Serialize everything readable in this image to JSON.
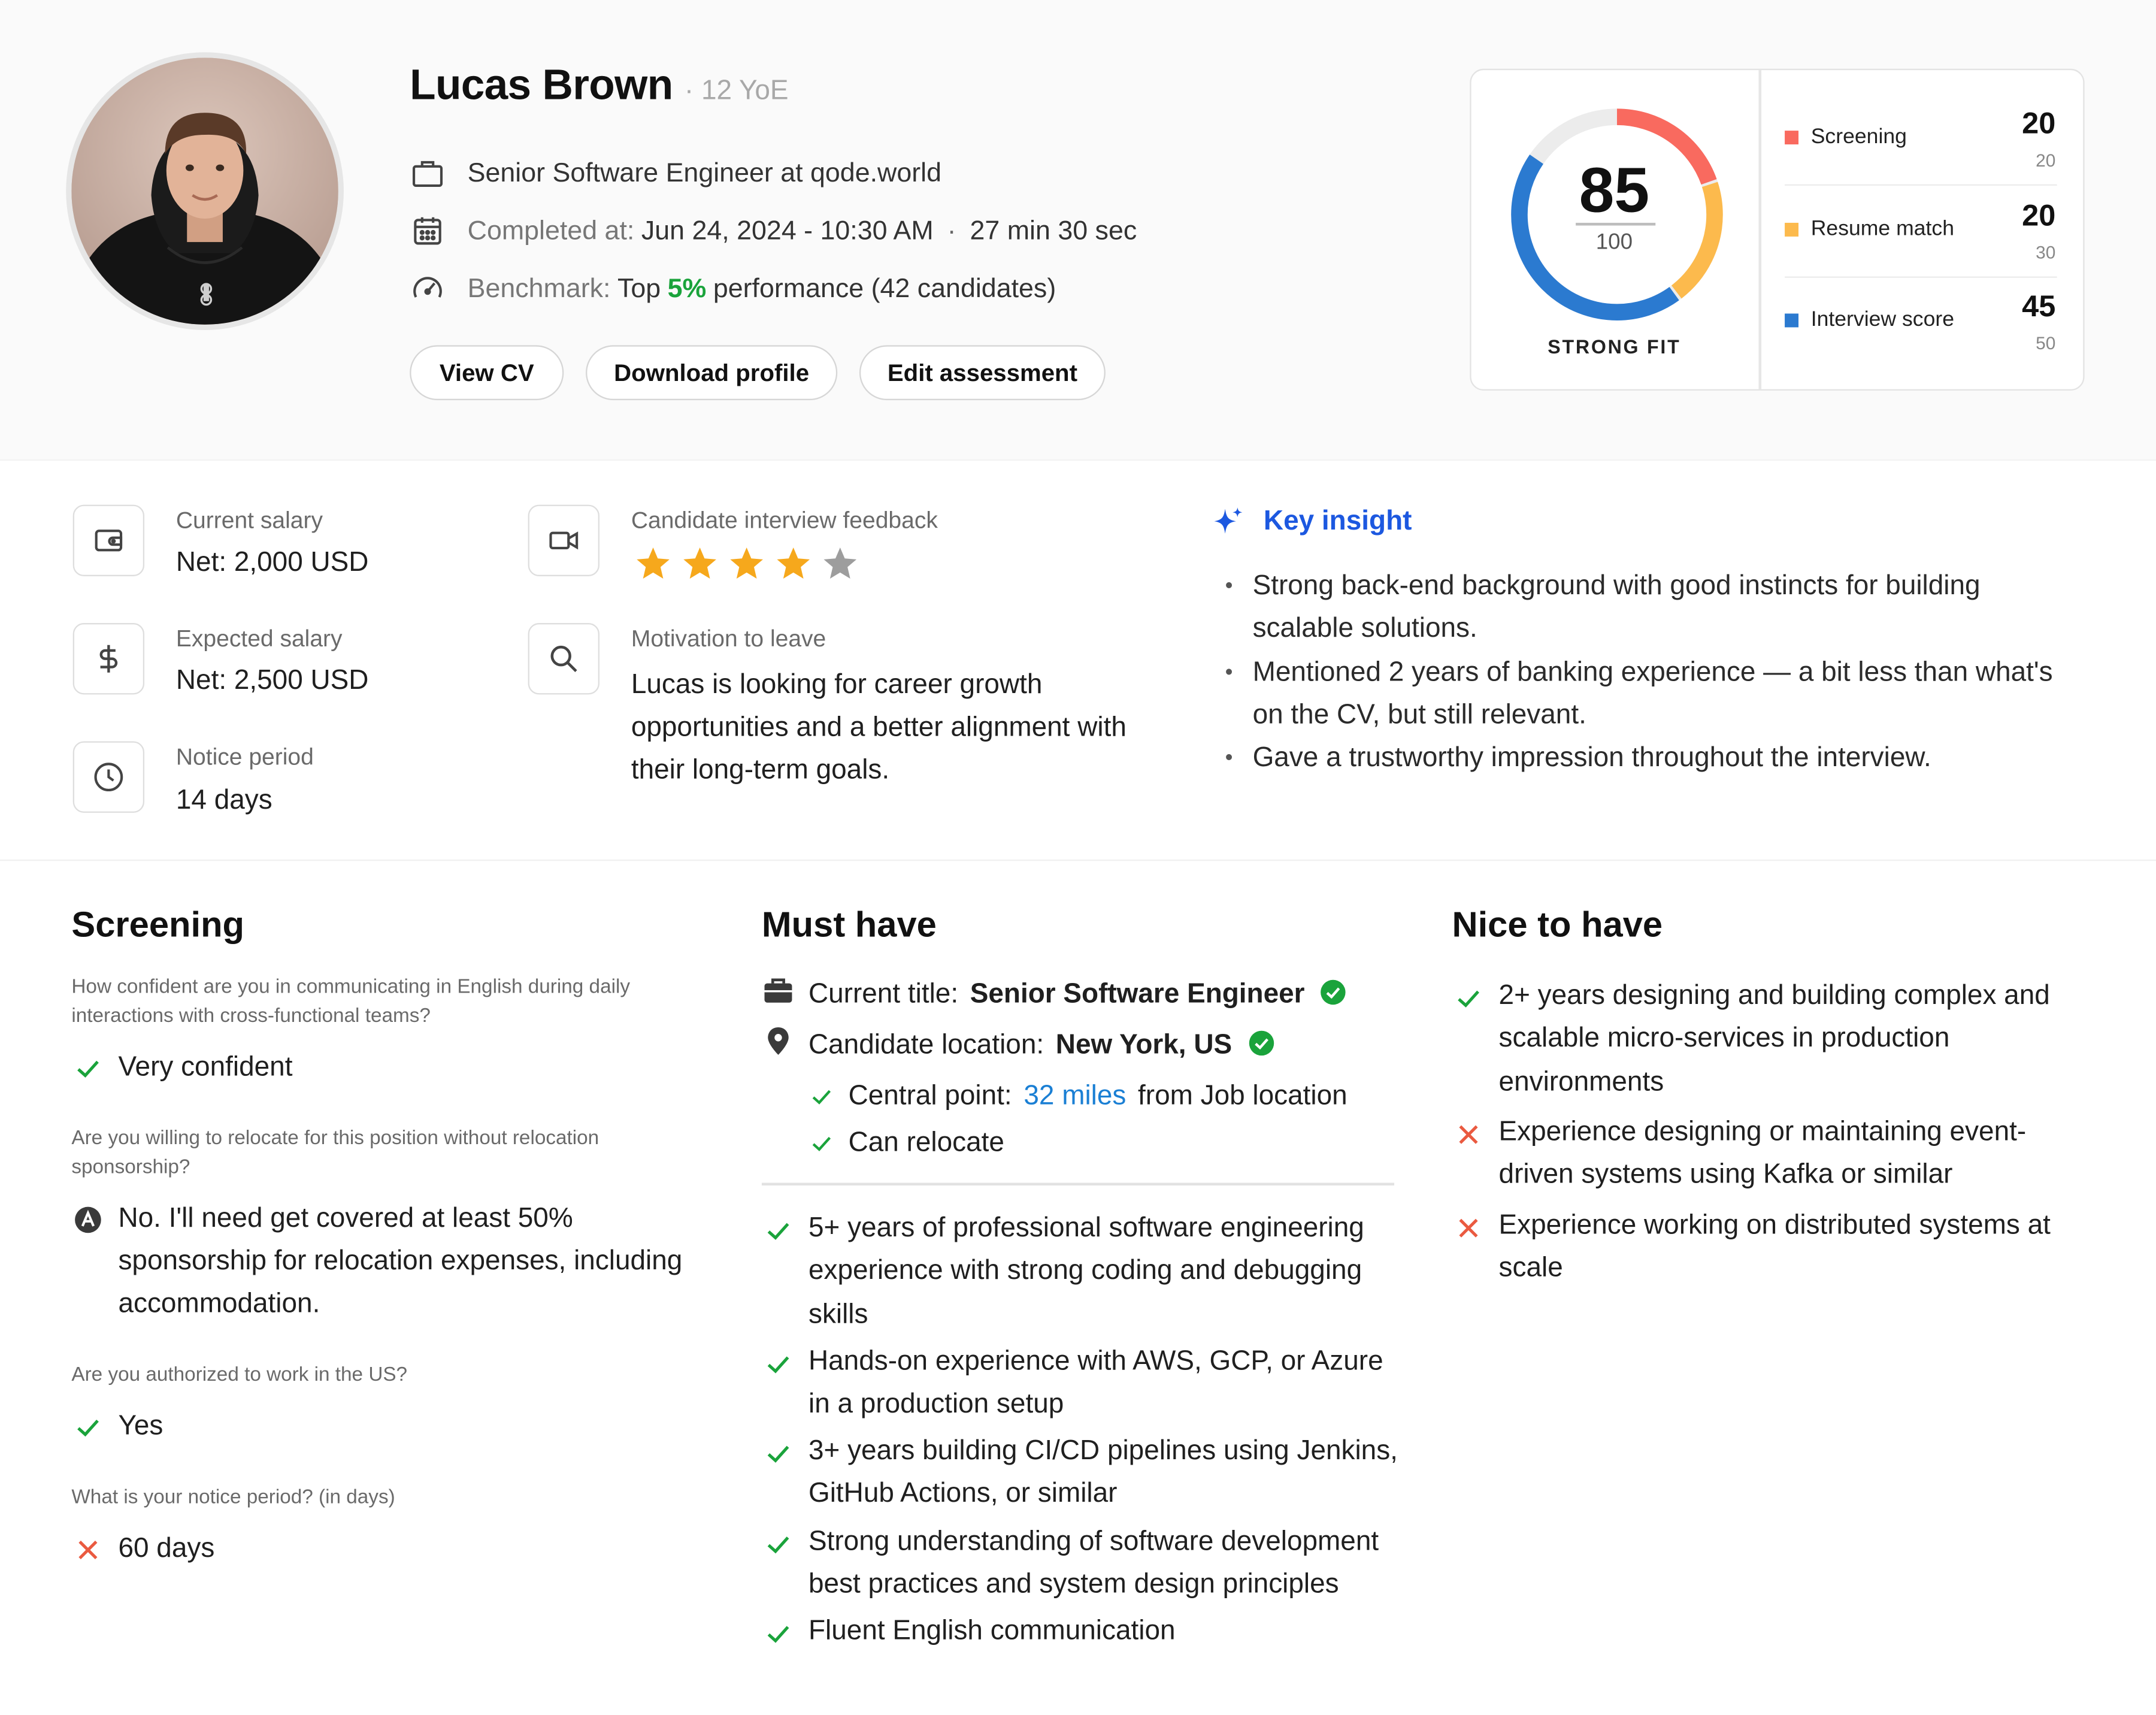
{
  "candidate": {
    "name": "Lucas Brown",
    "yoe": "· 12 YoE",
    "title": "Senior Software Engineer at qode.world",
    "completed_label": "Completed at:",
    "completed_value": "Jun 24, 2024 - 10:30 AM",
    "duration": "27 min 30 sec",
    "benchmark_label": "Benchmark:",
    "benchmark_top": "Top",
    "benchmark_pct": "5%",
    "benchmark_rest": "performance (42 candidates)"
  },
  "actions": {
    "view_cv": "View CV",
    "download": "Download profile",
    "edit": "Edit assessment"
  },
  "score": {
    "value": "85",
    "max": "100",
    "verdict": "STRONG FIT",
    "breakdown": [
      {
        "label": "Screening",
        "value": "20",
        "max": "20",
        "color": "#f96a5f"
      },
      {
        "label": "Resume match",
        "value": "20",
        "max": "30",
        "color": "#fcba4d"
      },
      {
        "label": "Interview score",
        "value": "45",
        "max": "50",
        "color": "#2b7ad0"
      }
    ],
    "track_color": "#ececec"
  },
  "details": {
    "current_salary_label": "Current salary",
    "current_salary": "Net: 2,000 USD",
    "expected_salary_label": "Expected salary",
    "expected_salary": "Net: 2,500 USD",
    "notice_label": "Notice period",
    "notice": "14 days",
    "feedback_label": "Candidate interview feedback",
    "feedback_rating": 4,
    "feedback_max": 5,
    "motivation_label": "Motivation to leave",
    "motivation": "Lucas is looking for career growth opportunities and a better alignment with their long-term goals."
  },
  "insight": {
    "title": "Key insight",
    "items": [
      "Strong back-end background with good instincts for building scalable solutions.",
      "Mentioned 2 years of banking experience — a bit less than what's on the CV, but still relevant.",
      "Gave a trustworthy impression throughout the interview."
    ]
  },
  "screening": {
    "title": "Screening",
    "items": [
      {
        "q": "How confident are you in communicating in English during daily interactions with cross-functional teams?",
        "a": "Very confident",
        "status": "pass"
      },
      {
        "q": "Are you willing to relocate for this position without relocation sponsorship?",
        "a": "No. I'll need get covered at least 50% sponsorship for relocation expenses, including accommodation.",
        "status": "ai"
      },
      {
        "q": "Are you authorized to work in the US?",
        "a": "Yes",
        "status": "pass"
      },
      {
        "q": "What is your notice period? (in days)",
        "a": "60 days",
        "status": "fail"
      }
    ]
  },
  "must_have": {
    "title": "Must have",
    "current_title_label": "Current title:",
    "current_title": "Senior Software Engineer",
    "location_label": "Candidate location:",
    "location": "New York, US",
    "central_label": "Central point:",
    "central_distance": "32 miles",
    "central_rest": "from Job location",
    "relocate": "Can relocate",
    "items": [
      "5+ years of professional software engineering experience with strong coding and debugging skills",
      "Hands-on experience with AWS, GCP, or Azure in a production setup",
      "3+ years building CI/CD pipelines using Jenkins, GitHub Actions, or similar",
      "Strong understanding of software development best practices and system design principles",
      "Fluent English communication"
    ]
  },
  "nice_to_have": {
    "title": "Nice to have",
    "items": [
      {
        "text": "2+ years designing and building complex and scalable micro-services in production environments",
        "status": "pass"
      },
      {
        "text": "Experience designing or maintaining event-driven systems using Kafka or similar",
        "status": "fail"
      },
      {
        "text": "Experience working on distributed systems at scale",
        "status": "fail"
      }
    ]
  },
  "colors": {
    "pass": "#1aa33b",
    "fail": "#ea5a40",
    "accent": "#1c58e0",
    "star": "#f6a81c",
    "star_off": "#9d9d9d"
  }
}
